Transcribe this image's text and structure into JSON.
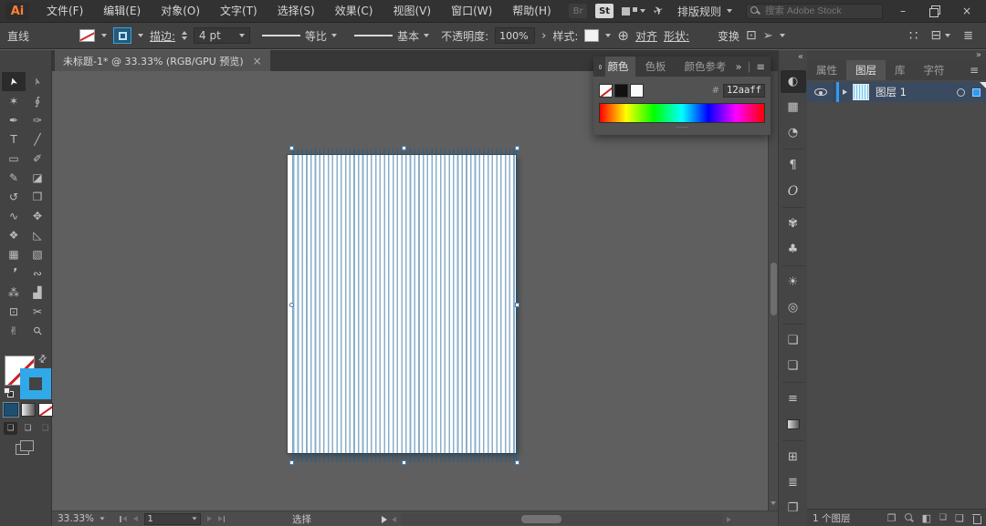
{
  "app": {
    "logo": "Ai"
  },
  "menu_bar": {
    "menus": [
      "文件(F)",
      "编辑(E)",
      "对象(O)",
      "文字(T)",
      "选择(S)",
      "效果(C)",
      "视图(V)",
      "窗口(W)",
      "帮助(H)"
    ],
    "bridge_badge": "Br",
    "stock_badge": "St",
    "typography_rule_label": "排版规则",
    "search_placeholder": "搜索 Adobe Stock"
  },
  "icons": {
    "minimize": "–",
    "close": "×",
    "menu": "≡",
    "list": "≣",
    "collapse_left": "«",
    "collapse_right": "»",
    "swap": "⇄",
    "globe": "⊕",
    "grid_dots": "∷",
    "panel_toggle": "⊟",
    "rocket": "✈",
    "transform_icon1": "⊡",
    "transform_icon2": "➢"
  },
  "options_bar": {
    "tool_name": "直线",
    "stroke_label": "描边:",
    "stroke_weight_value": "4 pt",
    "profile_value": "等比",
    "brush_value": "基本",
    "opacity_label": "不透明度:",
    "opacity_value": "100%",
    "opacity_more": "›",
    "style_label": "样式:",
    "align_label": "对齐",
    "shape_label": "形状:",
    "transform_label": "变换"
  },
  "document_tab": {
    "title": "未标题-1* @ 33.33% (RGB/GPU 预览)",
    "close_glyph": "×"
  },
  "toolbar": {
    "tools": [
      {
        "name": "selection-tool",
        "glyph": "➤",
        "selected": true
      },
      {
        "name": "direct-selection-tool",
        "glyph": "➢"
      },
      {
        "name": "magic-wand-tool",
        "glyph": "✶"
      },
      {
        "name": "lasso-tool",
        "glyph": "∮"
      },
      {
        "name": "pen-tool",
        "glyph": "✒"
      },
      {
        "name": "curvature-tool",
        "glyph": "✑"
      },
      {
        "name": "type-tool",
        "glyph": "T"
      },
      {
        "name": "line-segment-tool",
        "glyph": "╱"
      },
      {
        "name": "rectangle-tool",
        "glyph": "▭"
      },
      {
        "name": "paintbrush-tool",
        "glyph": "✐"
      },
      {
        "name": "shaper-tool",
        "glyph": "✎"
      },
      {
        "name": "eraser-tool",
        "glyph": "◪"
      },
      {
        "name": "rotate-tool",
        "glyph": "↺"
      },
      {
        "name": "scale-tool",
        "glyph": "❒"
      },
      {
        "name": "width-tool",
        "glyph": "∿"
      },
      {
        "name": "free-transform-tool",
        "glyph": "✥"
      },
      {
        "name": "shape-builder-tool",
        "glyph": "❖"
      },
      {
        "name": "perspective-grid-tool",
        "glyph": "◺"
      },
      {
        "name": "mesh-tool",
        "glyph": "▦"
      },
      {
        "name": "gradient-tool",
        "glyph": "▧"
      },
      {
        "name": "eyedropper-tool",
        "glyph": "❜"
      },
      {
        "name": "blend-tool",
        "glyph": "∾"
      },
      {
        "name": "symbol-sprayer-tool",
        "glyph": "⁂"
      },
      {
        "name": "column-graph-tool",
        "glyph": "▟"
      },
      {
        "name": "artboard-tool",
        "glyph": "⊡"
      },
      {
        "name": "slice-tool",
        "glyph": "✂"
      },
      {
        "name": "hand-tool",
        "glyph": "✌"
      },
      {
        "name": "zoom-tool",
        "glyph": "⚲"
      }
    ]
  },
  "color_panel": {
    "tabs": [
      "颜色",
      "色板",
      "颜色参考"
    ],
    "active_tab": "颜色",
    "hex_label": "#",
    "hex_value": "12aaff",
    "swatches": [
      "none",
      "black",
      "white"
    ]
  },
  "dock": {
    "panels": [
      {
        "name": "color",
        "glyph": "◐",
        "active": true
      },
      {
        "name": "swatches",
        "glyph": "▦"
      },
      {
        "name": "color-guide",
        "glyph": "◔"
      },
      {
        "name": "paragraph",
        "glyph": "¶",
        "gap": true
      },
      {
        "name": "opentype",
        "glyph": "O",
        "ot": true
      },
      {
        "name": "brushes",
        "glyph": "✾",
        "gap": true
      },
      {
        "name": "symbols",
        "glyph": "♣"
      },
      {
        "name": "appearance",
        "glyph": "☀",
        "gap": true
      },
      {
        "name": "transparency",
        "glyph": "◎"
      },
      {
        "name": "graphic-styles",
        "glyph": "❏",
        "gap": true
      },
      {
        "name": "artboards",
        "glyph": "❑"
      },
      {
        "name": "stroke",
        "glyph": "≡",
        "gap": true
      },
      {
        "name": "gradient",
        "glyph": ""
      },
      {
        "name": "transform",
        "glyph": "⊞",
        "gap": true
      },
      {
        "name": "align",
        "glyph": "≣"
      },
      {
        "name": "pathfinder",
        "glyph": "❐"
      }
    ]
  },
  "right_panels": {
    "tabs": [
      "属性",
      "图层",
      "库",
      "字符"
    ],
    "active_tab": "图层",
    "layers": {
      "layer_name": "图层 1",
      "count_label": "1 个图层"
    }
  },
  "status_bar": {
    "zoom_value": "33.33%",
    "artboard_number": "1",
    "tool_status": "选择"
  },
  "colors": {
    "accent_blue": "#2f9bf2",
    "stroke_swatch_blue": "#31a8e8",
    "stripe_stroke": "#12aaff",
    "layer_thumb": "#b5e5fb"
  }
}
